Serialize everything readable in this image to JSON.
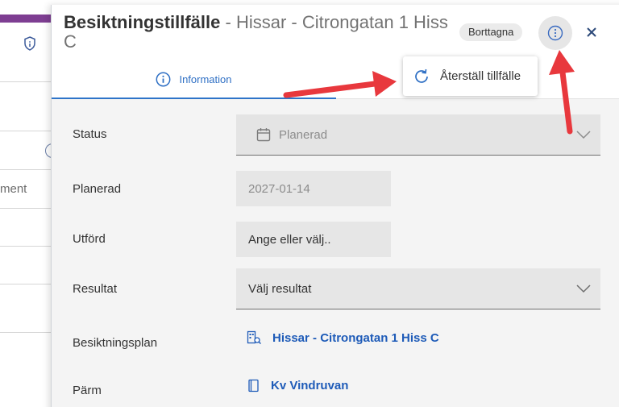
{
  "background_app": {
    "partial_text": "ment"
  },
  "dialog": {
    "title": "Besiktningstillfälle",
    "title_separator": " - ",
    "subtitle": "Hissar - Citrongatan 1 Hiss C",
    "status_badge": "Borttagna",
    "more_icon": "more-vertical-icon",
    "close_icon": "close-icon"
  },
  "tabs": [
    {
      "label": "Information",
      "icon": "info-circle-icon",
      "active": true
    }
  ],
  "menu": {
    "restore_label": "Återställ tillfälle",
    "restore_icon": "refresh-icon"
  },
  "form": {
    "status": {
      "label": "Status",
      "value": "Planerad",
      "disabled": true
    },
    "planned": {
      "label": "Planerad",
      "value": "2027-01-14",
      "disabled": true
    },
    "performed": {
      "label": "Utförd",
      "placeholder": "Ange eller välj.."
    },
    "result": {
      "label": "Resultat",
      "value": "Välj resultat"
    },
    "inspection_plan": {
      "label": "Besiktningsplan",
      "link": "Hissar - Citrongatan 1 Hiss C"
    },
    "binder": {
      "label": "Pärm",
      "link": "Kv Vindruvan"
    }
  },
  "colors": {
    "accent": "#2e74c9",
    "link": "#1e5bb8",
    "app_bar": "#7e3e92",
    "annotation_arrow": "#e8383d"
  }
}
